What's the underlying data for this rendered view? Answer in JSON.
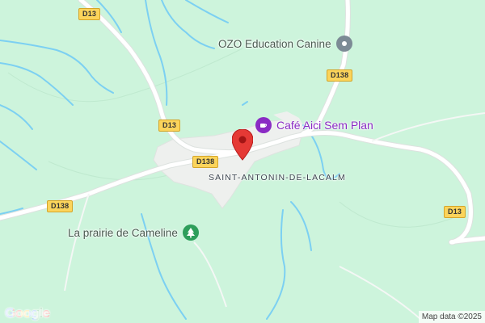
{
  "map": {
    "road_labels": [
      "D13",
      "D13",
      "D138",
      "D138",
      "D138",
      "D13"
    ],
    "poi": {
      "ozo": "OZO Education Canine",
      "cafe": "Café Aici Sem Plan",
      "prairie": "La prairie de Cameline"
    },
    "town": "SAINT-ANTONIN-DE-LACALM",
    "footer": {
      "google": "Google",
      "map_data": "Map data ©2025"
    },
    "colors": {
      "land": "#cdf4dc",
      "water": "#7cd0f2",
      "road": "#ffffff",
      "badge": "#fbd45b",
      "pin": "#e53935",
      "cafe_purple": "#8a2bc4",
      "park_green": "#2e9e5b"
    },
    "icons": [
      "location-pin-icon",
      "cafe-icon",
      "park-tree-icon",
      "place-marker-icon"
    ]
  }
}
